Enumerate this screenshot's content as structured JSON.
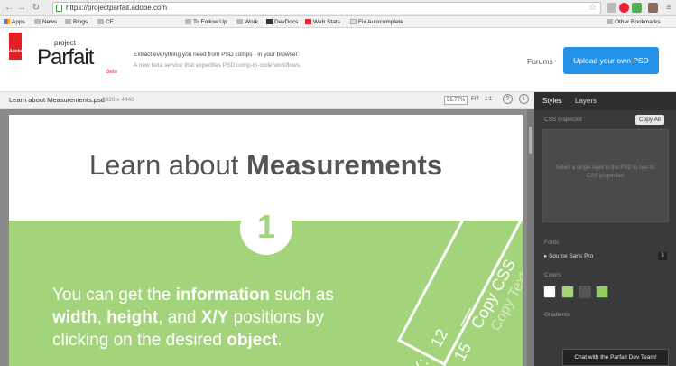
{
  "browser": {
    "url": "https://projectparfait.adobe.com",
    "bookmarks": [
      "Apps",
      "News",
      "Blogs",
      "CF",
      "To Follow Up",
      "Work",
      "DevDocs",
      "Web Stats",
      "Fix Autocomplete"
    ],
    "other_bookmarks": "Other Bookmarks"
  },
  "header": {
    "adobe_logo": "Adobe",
    "logo_small": "project",
    "logo_big": "Parfait",
    "logo_beta": "beta",
    "tagline": "Extract everything you need from PSD comps - in your browser.",
    "subtagline": "A new beta service that expedites PSD comp-to-code workflows.",
    "forums": "Forums",
    "upload": "Upload your own PSD"
  },
  "toolbar": {
    "filename": "Learn about Measurements.psd",
    "dimensions": "1920 x 4440",
    "zoom": "56.77%",
    "fit": "FIT",
    "one_to_one": "1:1",
    "help": "?",
    "info": "i"
  },
  "document": {
    "title_light": "Learn about ",
    "title_bold": "Measurements",
    "step_number": "1",
    "line1_a": "You can get the ",
    "line1_b": "information",
    "line1_c": " such as",
    "line2_a": "width",
    "line2_b": ", ",
    "line2_c": "height",
    "line2_d": ", and ",
    "line2_e": "X/Y",
    "line2_f": " positions by",
    "line3_a": "clicking on the desired ",
    "line3_b": "object",
    "line3_c": ".",
    "ribbon_copy_css": "Copy CSS",
    "ribbon_copy_text": "Copy Text",
    "ribbon_12": "12",
    "ribbon_15": "15",
    "ribbon_x": "X:"
  },
  "panel": {
    "tab_styles": "Styles",
    "tab_layers": "Layers",
    "css_inspector": "CSS Inspector",
    "copy_all": "Copy All",
    "inspector_msg": "Select a single layer in the PSD to see its CSS properties",
    "fonts_label": "Fonts",
    "font_name": "Source Sans Pro",
    "font_count": "3",
    "colors_label": "Colors",
    "swatches": [
      "#ffffff",
      "#a3d37a",
      "#555555",
      "#8fcf5f"
    ],
    "gradients_label": "Gradients",
    "chat": "Chat with the Parfait Dev Team!"
  }
}
